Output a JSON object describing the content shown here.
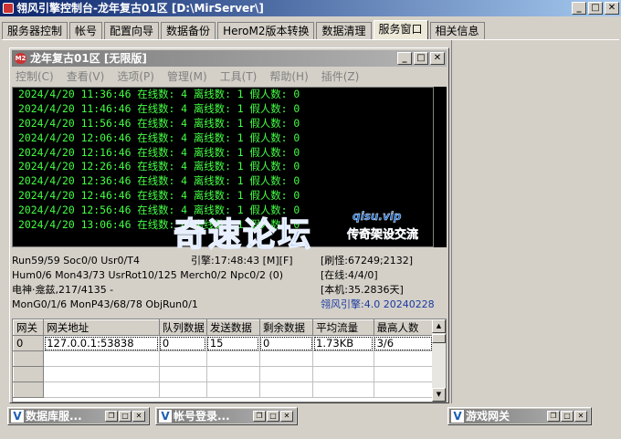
{
  "window": {
    "title": "翎风引擎控制台-龙年复古01区 [D:\\MirServer\\]",
    "buttons": {
      "minimize": "_",
      "maximize": "□",
      "close": "✕"
    }
  },
  "tabs": [
    "服务器控制",
    "帐号",
    "配置向导",
    "数据备份",
    "HeroM2版本转换",
    "数据清理",
    "服务窗口",
    "相关信息"
  ],
  "active_tab": "服务窗口",
  "child_window": {
    "title": "龙年复古01区 [无限版]",
    "icon_text": "M2",
    "menu": [
      "控制(C)",
      "查看(V)",
      "选项(P)",
      "管理(M)",
      "工具(T)",
      "帮助(H)",
      "插件(Z)"
    ]
  },
  "log_lines": [
    "2024/4/20 11:36:46 在线数: 4 离线数: 1 假人数: 0",
    "2024/4/20 11:46:46 在线数: 4 离线数: 1 假人数: 0",
    "2024/4/20 11:56:46 在线数: 4 离线数: 1 假人数: 0",
    "2024/4/20 12:06:46 在线数: 4 离线数: 1 假人数: 0",
    "2024/4/20 12:16:46 在线数: 4 离线数: 1 假人数: 0",
    "2024/4/20 12:26:46 在线数: 4 离线数: 1 假人数: 0",
    "2024/4/20 12:36:46 在线数: 4 离线数: 1 假人数: 0",
    "2024/4/20 12:46:46 在线数: 4 离线数: 1 假人数: 0",
    "2024/4/20 12:56:46 在线数: 4 离线数: 1 假人数: 0",
    "2024/4/20 13:06:46 在线数: 4 离线数: 1 假人数: 0"
  ],
  "watermark": {
    "main": "奇速论坛",
    "url": "qisu.vip",
    "slogan": "传奇架设交流"
  },
  "status": {
    "run": "Run59/59 Soc0/0 Usr0/T4",
    "engine": "引擎:17:48:43 [M][F]",
    "refresh": "[刷怪:67249;2132]",
    "hum": "Hum0/6 Mon43/73 UsrRot10/125 Merch0/2 Npc0/2 (0)",
    "online": "[在线:4/4/0]",
    "god": "电神·龛兹,217/4135 -",
    "local": "[本机:35.2836天]",
    "mon": "MonG0/1/6 MonP43/68/78 ObjRun0/1",
    "version": "翎风引擎:4.0 20240228"
  },
  "grid": {
    "columns": [
      "网关",
      "网关地址",
      "队列数据",
      "发送数据",
      "剩余数据",
      "平均流量",
      "最高人数"
    ],
    "rows": [
      [
        "0",
        "127.0.0.1:53838",
        "0",
        "15",
        "0",
        "1.73KB",
        "3/6"
      ]
    ]
  },
  "minimized_windows": [
    {
      "title": "数据库服..."
    },
    {
      "title": "帐号登录..."
    },
    {
      "title": "游戏网关"
    }
  ]
}
